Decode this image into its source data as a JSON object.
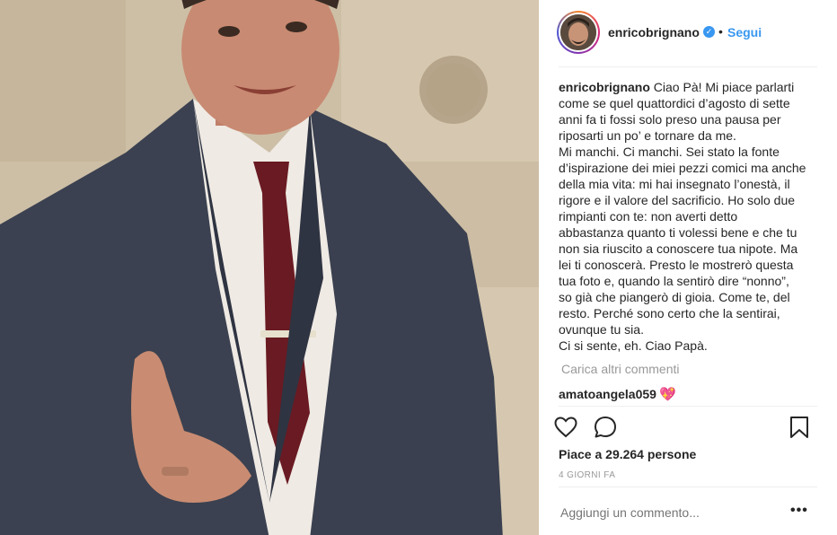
{
  "post": {
    "photo_alt_icon": "photo-of-man-in-suit",
    "author": {
      "username": "enricobrignano",
      "verified": true,
      "verified_icon": "verified-badge-icon",
      "separator": "•",
      "follow_label": "Segui"
    },
    "caption": {
      "username": "enricobrignano",
      "lines": [
        "Ciao Pà! Mi piace parlarti",
        "come se quel quattordici d’agosto di sette",
        "anni fa ti fossi solo preso una pausa per",
        "riposarti un po’ e tornare da me.",
        "Mi manchi. Ci manchi. Sei stato la fonte",
        "d’ispirazione dei miei pezzi comici ma anche",
        "della mia vita: mi hai insegnato l’onestà, il",
        "rigore e il valore del sacrificio. Ho solo due",
        "rimpianti con te: non averti detto",
        "abbastanza quanto ti volessi bene e che tu",
        "non sia riuscito a conoscere tua nipote. Ma",
        "lei ti conoscerà. Presto le mostrerò questa",
        "tua foto e, quando la sentirò dire “nonno”,",
        "so già che piangerò di gioia. Come te, del",
        "resto. Perché sono certo che la sentirai,",
        "ovunque tu sia.",
        "Ci si sente, eh. Ciao Papà."
      ]
    },
    "load_more_label": "Carica altri commenti",
    "comments": [
      {
        "username": "amatoangela059",
        "text": "💖"
      }
    ],
    "actions": {
      "like_icon": "heart-outline-icon",
      "comment_icon": "comment-bubble-icon",
      "save_icon": "bookmark-icon"
    },
    "likes_text": "Piace a 29.264 persone",
    "timestamp": "4 GIORNI FA",
    "add_comment_placeholder": "Aggiungi un commento...",
    "more_options": "•••",
    "colors": {
      "accent": "#3897f0",
      "text": "#262626",
      "muted": "#999999",
      "divider": "#efefef"
    }
  }
}
